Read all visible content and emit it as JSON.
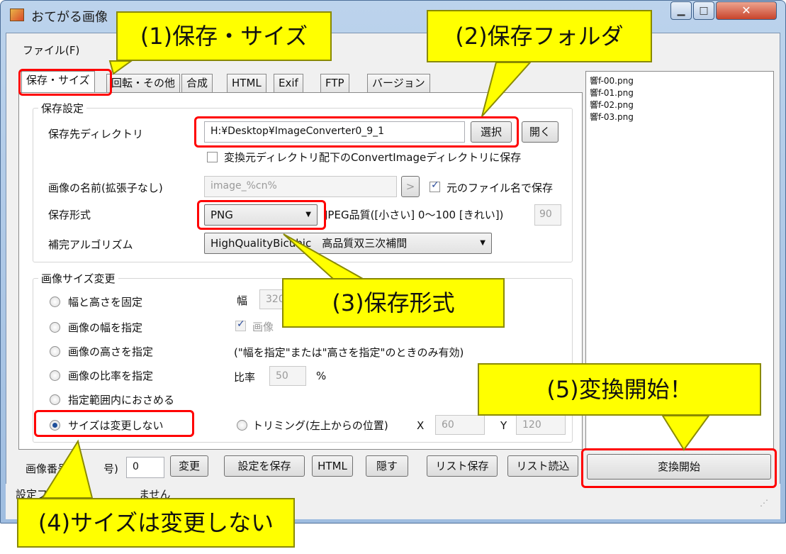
{
  "window": {
    "title": "おてがる画像",
    "menu": {
      "file": "ファイル(F)"
    }
  },
  "tabs": [
    {
      "label": "保存・サイズ",
      "active": true
    },
    {
      "label": "回転・その他"
    },
    {
      "label": "合成"
    },
    {
      "label": "HTML"
    },
    {
      "label": "Exif"
    },
    {
      "label": "FTP"
    },
    {
      "label": "バージョン"
    }
  ],
  "save_settings": {
    "group_label": "保存設定",
    "dir_label": "保存先ディレクトリ",
    "dir_value": "H:¥Desktop¥ImageConverter0_9_1",
    "select_button": "選択",
    "open_button": "開く",
    "convert_dir_checkbox": "変換元ディレクトリ配下のConvertImageディレクトリに保存",
    "name_label": "画像の名前(拡張子なし)",
    "name_value": "image_%cn%",
    "name_arrow": ">",
    "keep_name_checkbox": "元のファイル名で保存",
    "format_label": "保存形式",
    "format_value": "PNG",
    "jpeg_quality_label": "JPEG品質([小さい] 0〜100 [きれい])",
    "jpeg_quality_value": "90",
    "interp_label": "補完アルゴリズム",
    "interp_value": "HighQualityBicubic　高品質双三次補間"
  },
  "resize": {
    "group_label": "画像サイズ変更",
    "radios": [
      "幅と高さを固定",
      "画像の幅を指定",
      "画像の高さを指定",
      "画像の比率を指定",
      "指定範囲内におさめる",
      "サイズは変更しない"
    ],
    "selected_index": 5,
    "width_label": "幅",
    "width_value": "320",
    "ratio_checkbox": "画像",
    "note": "(\"幅を指定\"または\"高さを指定\"のときのみ有効)",
    "ratio_label": "比率",
    "ratio_value": "50",
    "ratio_unit": "%",
    "trim_label": "トリミング(左上からの位置)",
    "x_label": "X",
    "x_value": "60",
    "y_label": "Y",
    "y_value": "120"
  },
  "bottom": {
    "number_label": "画像番号",
    "number_label_tail": "号)",
    "number_value": "0",
    "change_button": "変更",
    "save_settings_button": "設定を保存",
    "html_button": "HTML",
    "hide_button": "隠す",
    "list_save_button": "リスト保存",
    "list_load_button": "リスト読込",
    "convert_button": "変換開始"
  },
  "status": {
    "text": "設定フ",
    "text_tail": "ません"
  },
  "file_list": [
    "響f-00.png",
    "響f-01.png",
    "響f-02.png",
    "響f-03.png"
  ],
  "callouts": {
    "c1": "(1)保存・サイズ",
    "c2": "(2)保存フォルダ",
    "c3": "(3)保存形式",
    "c4": "(4)サイズは変更しない",
    "c5": "(5)変換開始！"
  },
  "colors": {
    "callout_fill": "#ffff00",
    "highlight_border": "#ff0000"
  }
}
